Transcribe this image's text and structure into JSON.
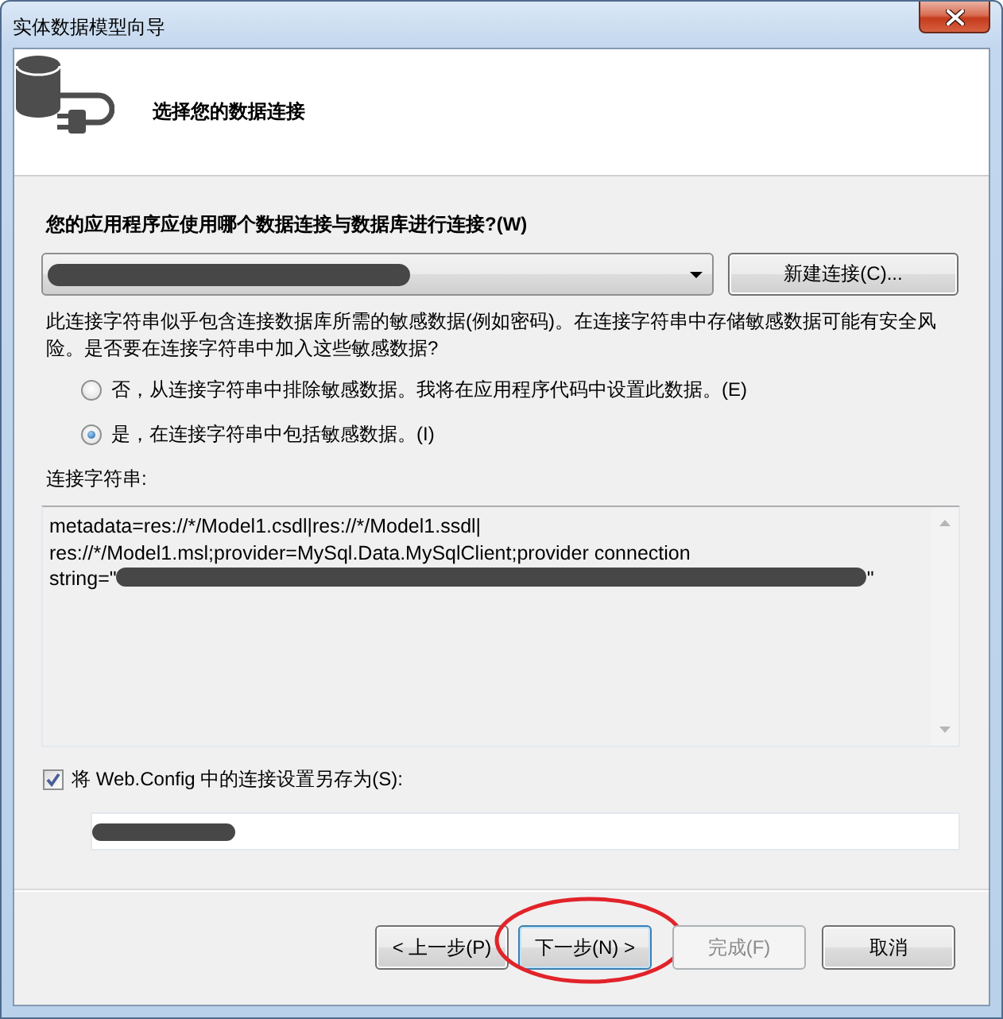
{
  "window": {
    "title": "实体数据模型向导"
  },
  "header": {
    "heading": "选择您的数据连接"
  },
  "connection_prompt": {
    "label": "您的应用程序应使用哪个数据连接与数据库进行连接?(W)"
  },
  "connection_dropdown": {
    "value_redacted": true
  },
  "new_connection_button": {
    "label": "新建连接(C)..."
  },
  "sensitive_notice": "此连接字符串似乎包含连接数据库所需的敏感数据(例如密码)。在连接字符串中存储敏感数据可能有安全风险。是否要在连接字符串中加入这些敏感数据?",
  "sensitive_options": [
    {
      "label": "否，从连接字符串中排除敏感数据。我将在应用程序代码中设置此数据。(E)",
      "selected": false
    },
    {
      "label": "是，在连接字符串中包括敏感数据。(I)",
      "selected": true
    }
  ],
  "connection_string": {
    "label": "连接字符串:",
    "lines": [
      [
        {
          "kind": "text",
          "text": "metadata=res://*/Model1.csdl|res://*/Model1.ssdl|"
        }
      ],
      [
        {
          "kind": "text",
          "text": "res://*/Model1.msl;provider=MySql.Data.MySqlClient;provider connection"
        }
      ],
      [
        {
          "kind": "text",
          "text": "string=\""
        },
        {
          "kind": "redacted"
        },
        {
          "kind": "text",
          "text": "\""
        }
      ]
    ]
  },
  "save_setting": {
    "checked": true,
    "label": "将 Web.Config 中的连接设置另存为(S):",
    "value_redacted": true
  },
  "footer_buttons": [
    {
      "label": "< 上一步(P)",
      "disabled": false,
      "default": false,
      "circled": false
    },
    {
      "label": "下一步(N) >",
      "disabled": false,
      "default": true,
      "circled": true
    },
    {
      "label": "完成(F)",
      "disabled": true,
      "default": false,
      "circled": false
    },
    {
      "label": "取消",
      "disabled": false,
      "default": false,
      "circled": false
    }
  ]
}
